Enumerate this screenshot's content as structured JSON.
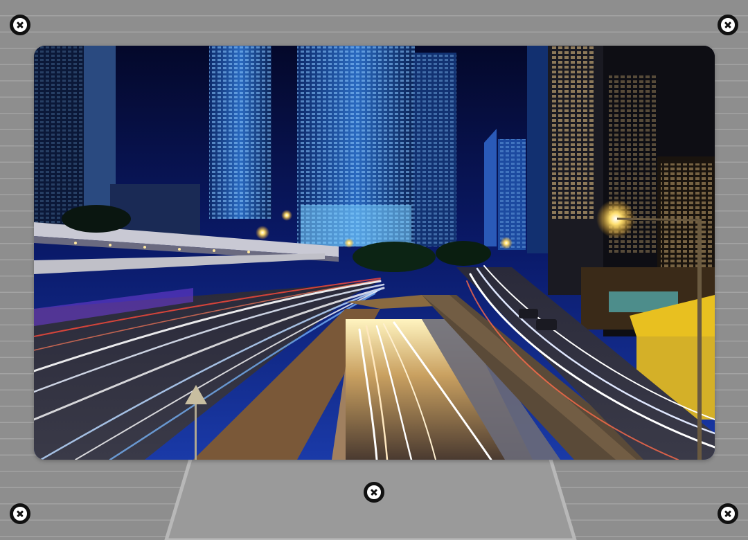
{
  "photo": {
    "subject": "night-city-highway-light-trails"
  },
  "controls": {
    "close_icon": "close-icon",
    "colors": {
      "icon_ring": "#111111",
      "icon_fill": "#ffffff",
      "background": "#8e8e8e",
      "stand": "#9c9c9c"
    }
  }
}
